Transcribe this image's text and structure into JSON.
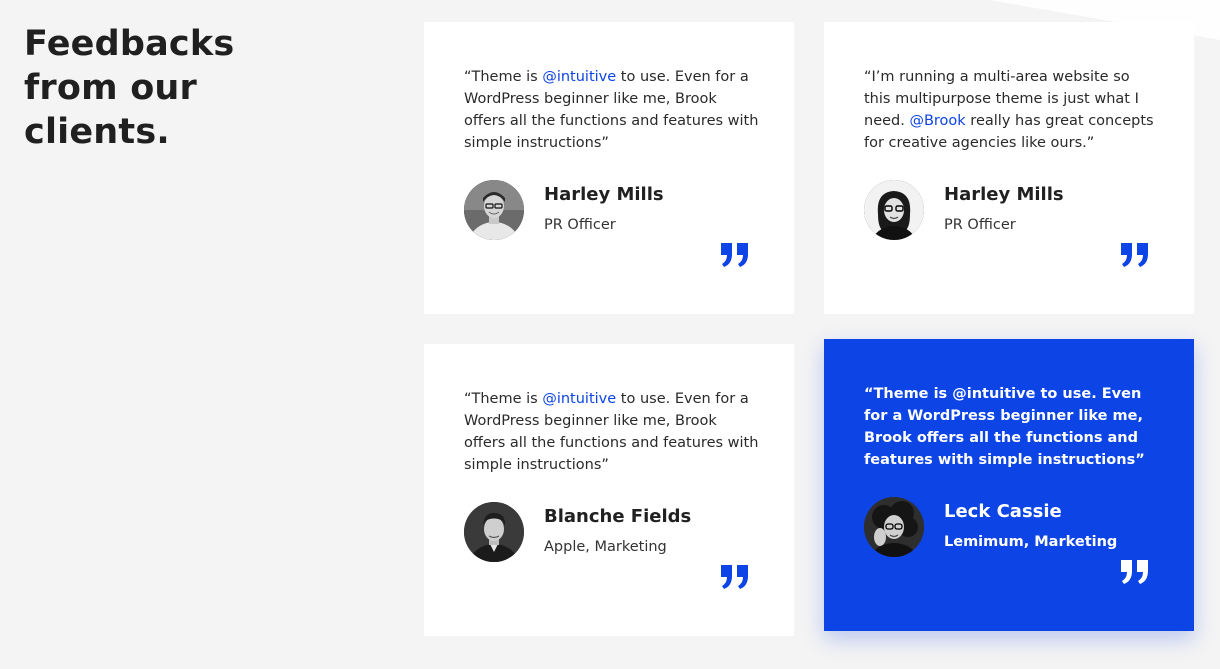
{
  "section": {
    "heading_lines": [
      "Feedbacks",
      "from our",
      "clients."
    ]
  },
  "colors": {
    "accent": "#0d44e6",
    "background": "#f4f4f4",
    "card": "#ffffff",
    "text": "#202020"
  },
  "testimonials": [
    {
      "quote_parts": [
        "“Theme is ",
        "@intuitive",
        " to use. Even for a WordPress beginner like me, Brook offers all the functions and features with simple instructions”"
      ],
      "name": "Harley Mills",
      "role": "PR Officer",
      "avatar_icon": "man-glasses-portrait",
      "quote_icon": "closing-quote-icon"
    },
    {
      "quote_parts": [
        "“I’m running a multi-area website so this multipurpose theme is just what I need. ",
        "@Brook",
        " really has great concepts for creative agencies like ours.”"
      ],
      "name": "Harley Mills",
      "role": "PR Officer",
      "avatar_icon": "woman-glasses-portrait",
      "quote_icon": "closing-quote-icon"
    },
    {
      "quote_parts": [
        "“Theme is ",
        "@intuitive",
        " to use. Even for a WordPress beginner like me, Brook offers all the functions and features with simple instructions”"
      ],
      "name": "Blanche Fields",
      "role": "Apple, Marketing",
      "avatar_icon": "man-suit-portrait",
      "quote_icon": "closing-quote-icon"
    },
    {
      "quote_parts": [
        "“Theme is ",
        "@intuitive",
        " to use. Even for a WordPress beginner like me, Brook offers all the functions and features with simple instructions”"
      ],
      "name": "Leck Cassie",
      "role": "Lemimum, Marketing",
      "avatar_icon": "woman-curly-hair-portrait",
      "quote_icon": "closing-quote-icon",
      "highlighted": true
    }
  ]
}
